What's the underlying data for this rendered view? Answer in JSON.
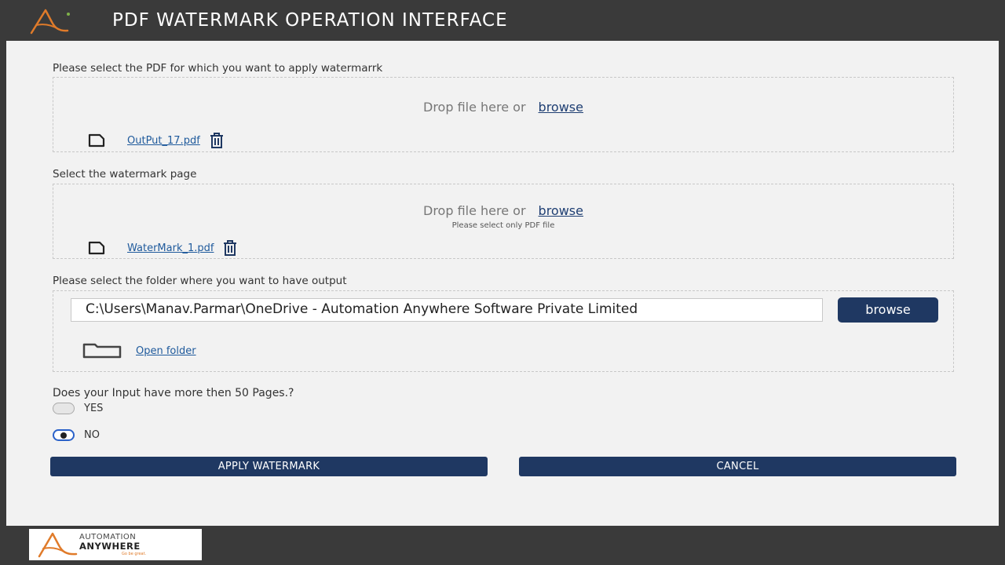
{
  "window": {
    "title": "PDF WATERMARK OPERATION INTERFACE",
    "accent_color": "#1f3862",
    "logo_color": "#e07b2a"
  },
  "pdf_section": {
    "label": "Please select the PDF for which you want to apply watermarrk",
    "drop_text": "Drop file here or",
    "browse_link": "browse",
    "file_name": "OutPut_17.pdf",
    "file_icon": "file-icon",
    "delete_icon": "trash-icon"
  },
  "watermark_section": {
    "label": "Select the watermark page",
    "drop_text": "Drop file here or",
    "browse_link": "browse",
    "hint": "Please select only PDF file",
    "file_name": "WaterMark_1.pdf",
    "file_icon": "file-icon",
    "delete_icon": "trash-icon"
  },
  "output_section": {
    "label": "Please select the folder where you want to have output",
    "path_value": "C:\\Users\\Manav.Parmar\\OneDrive - Automation Anywhere Software Private Limited",
    "browse_button": "browse",
    "open_folder_link": "Open folder",
    "folder_icon": "folder-icon"
  },
  "pages_question": {
    "question": "Does your Input have more then 50 Pages.?",
    "options": [
      {
        "label": "YES",
        "selected": false
      },
      {
        "label": "NO",
        "selected": true
      }
    ]
  },
  "actions": {
    "apply_label": "APPLY WATERMARK",
    "cancel_label": "CANCEL"
  },
  "footer": {
    "logo_line1": "AUTOMATION",
    "logo_line2": "ANYWHERE",
    "logo_tagline": "Go be great."
  }
}
